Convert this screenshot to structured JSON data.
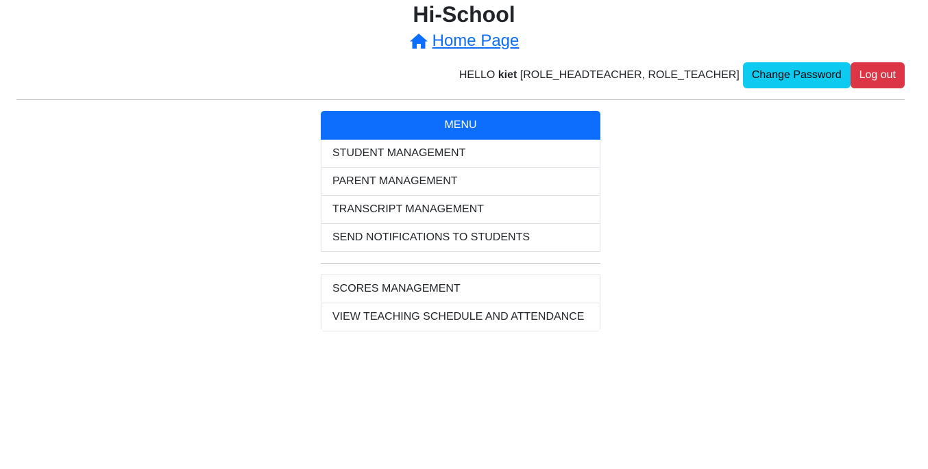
{
  "header": {
    "title": "Hi-School",
    "home_link_label": " Home Page"
  },
  "userbar": {
    "greeting_prefix": "HELLO ",
    "username": "kiet",
    "roles": " [ROLE_HEADTEACHER, ROLE_TEACHER]",
    "change_password_label": "Change Password",
    "logout_label": "Log out"
  },
  "menu": {
    "header": "MENU",
    "group1": [
      {
        "label": "STUDENT MANAGEMENT"
      },
      {
        "label": "PARENT MANAGEMENT"
      },
      {
        "label": "TRANSCRIPT MANAGEMENT"
      },
      {
        "label": "SEND NOTIFICATIONS TO STUDENTS"
      }
    ],
    "group2": [
      {
        "label": "SCORES MANAGEMENT"
      },
      {
        "label": "VIEW TEACHING SCHEDULE AND ATTENDANCE"
      }
    ]
  },
  "colors": {
    "primary": "#0d6efd",
    "info": "#0dcaf0",
    "danger": "#dc3545"
  },
  "icons": {
    "home": "home-icon"
  }
}
